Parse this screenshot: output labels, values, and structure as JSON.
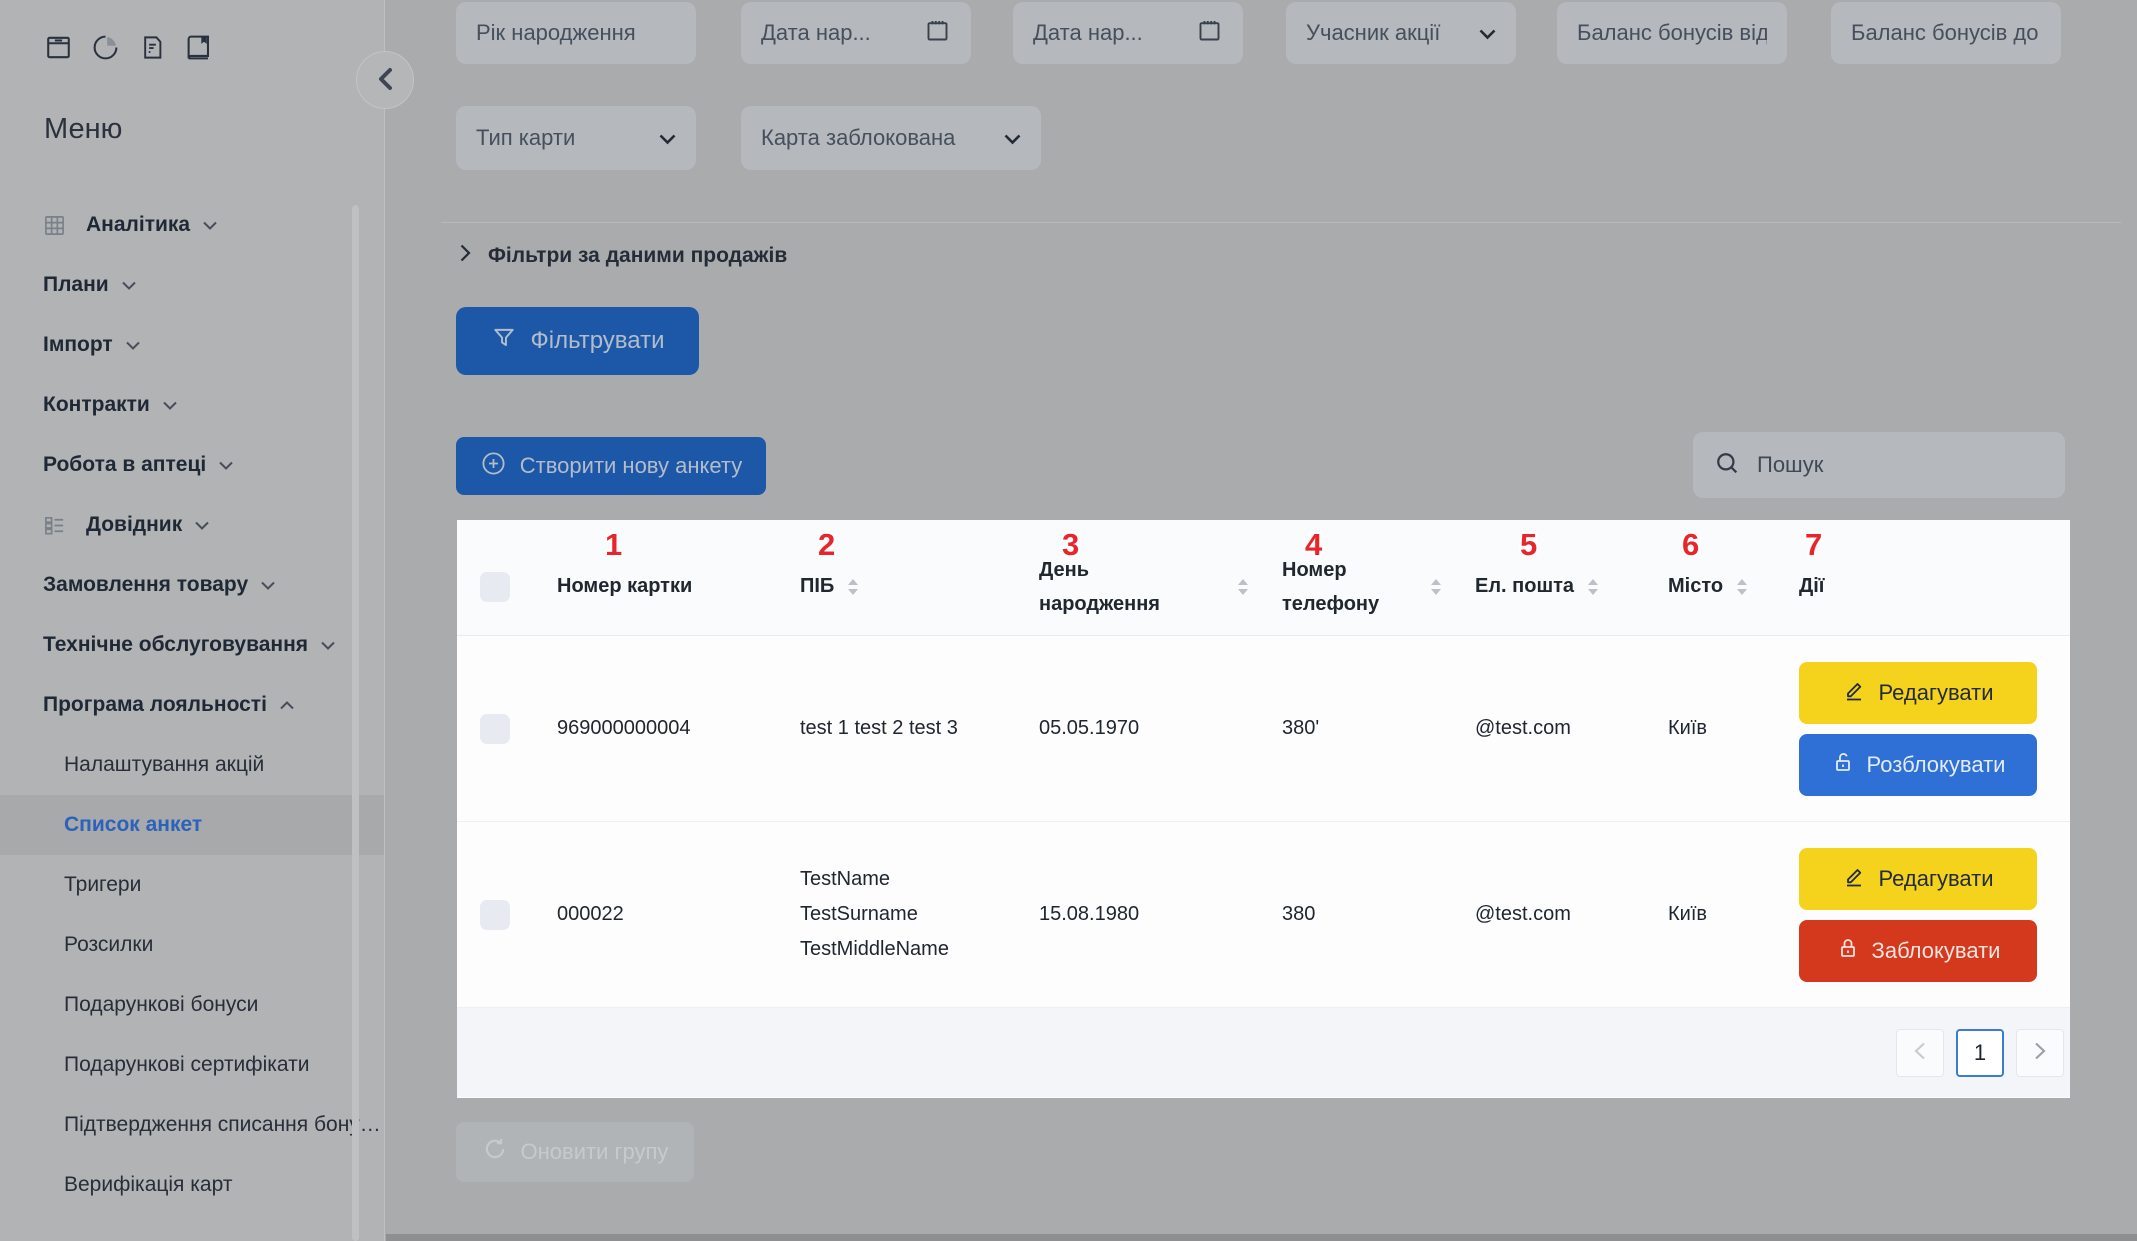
{
  "sidebar": {
    "menu_title": "Меню",
    "top_icons": [
      "archive-icon",
      "pie-chart-icon",
      "document-icon",
      "book-icon"
    ],
    "items": [
      {
        "label": "Аналітика",
        "icon": "grid-icon",
        "expandable": true
      },
      {
        "label": "Плани",
        "expandable": true
      },
      {
        "label": "Імпорт",
        "expandable": true
      },
      {
        "label": "Контракти",
        "expandable": true
      },
      {
        "label": "Робота в аптеці",
        "expandable": true
      },
      {
        "label": "Довідник",
        "icon": "list-icon",
        "expandable": true
      },
      {
        "label": "Замовлення товару",
        "expandable": true
      },
      {
        "label": "Технічне обслуговування",
        "expandable": true
      },
      {
        "label": "Програма лояльності",
        "expandable": true,
        "expanded": true
      }
    ],
    "subitems": [
      {
        "label": "Налаштування акцій",
        "active": false
      },
      {
        "label": "Список анкет",
        "active": true
      },
      {
        "label": "Тригери",
        "active": false
      },
      {
        "label": "Розсилки",
        "active": false
      },
      {
        "label": "Подарункові бонуси",
        "active": false
      },
      {
        "label": "Подарункові сертифікати",
        "active": false
      },
      {
        "label": "Підтвердження списання бону…",
        "active": false
      },
      {
        "label": "Верифікація карт",
        "active": false
      }
    ]
  },
  "filters": {
    "row1": [
      {
        "placeholder": "Рік народження",
        "type": "text"
      },
      {
        "placeholder": "Дата нар...",
        "type": "date"
      },
      {
        "placeholder": "Дата нар...",
        "type": "date"
      },
      {
        "placeholder": "Учасник акції",
        "type": "select"
      },
      {
        "placeholder": "Баланс бонусів від",
        "type": "text"
      },
      {
        "placeholder": "Баланс бонусів до",
        "type": "text"
      }
    ],
    "row2": [
      {
        "placeholder": "Тип карти",
        "type": "select"
      },
      {
        "placeholder": "Карта заблокована",
        "type": "select"
      }
    ],
    "sales_toggle": "Фільтри за даними продажів",
    "filter_button": "Фільтрувати"
  },
  "actions": {
    "create_button": "Створити нову анкету",
    "search_placeholder": "Пошук",
    "update_group_button": "Оновити групу"
  },
  "table": {
    "annotations": [
      "1",
      "2",
      "3",
      "4",
      "5",
      "6",
      "7"
    ],
    "columns": [
      {
        "label": "Номер картки",
        "sortable": false
      },
      {
        "label": "ПІБ",
        "sortable": true
      },
      {
        "label_line1": "День",
        "label_line2": "народження",
        "sortable": true
      },
      {
        "label_line1": "Номер",
        "label_line2": "телефону",
        "sortable": true
      },
      {
        "label": "Ел. пошта",
        "sortable": true
      },
      {
        "label": "Місто",
        "sortable": true
      },
      {
        "label": "Дії",
        "sortable": false
      }
    ],
    "rows": [
      {
        "card_number": "969000000004",
        "name_lines": [
          "test 1 test 2 test 3"
        ],
        "birthday": "05.05.1970",
        "phone": "380'",
        "email": "@test.com",
        "city": "Київ",
        "actions": [
          {
            "label": "Редагувати",
            "type": "edit"
          },
          {
            "label": "Розблокувати",
            "type": "unlock"
          }
        ]
      },
      {
        "card_number": "000022",
        "name_lines": [
          "TestName",
          "TestSurname",
          "TestMiddleName"
        ],
        "birthday": "15.08.1980",
        "phone": "380",
        "email": "@test.com",
        "city": "Київ",
        "actions": [
          {
            "label": "Редагувати",
            "type": "edit"
          },
          {
            "label": "Заблокувати",
            "type": "lock"
          }
        ]
      }
    ],
    "pagination": {
      "current_page": "1"
    }
  },
  "colors": {
    "page_background": "#aaabad",
    "sidebar_background": "#b2b3b5",
    "primary_blue": "#1d57a8",
    "action_blue": "#2e70d5",
    "action_yellow": "#f5d31d",
    "action_red": "#d5391d",
    "active_link_blue": "#2a62bc",
    "annotation_red": "#e9242b",
    "table_background": "#fdfdfe"
  }
}
